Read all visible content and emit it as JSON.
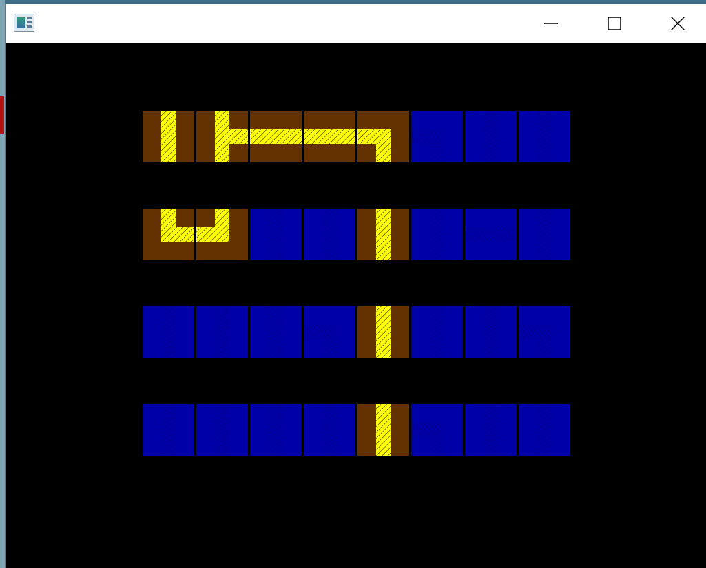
{
  "window": {
    "title": "",
    "controls": {
      "minimize_icon": "minimize-icon",
      "maximize_icon": "maximize-icon",
      "close_icon": "close-icon"
    }
  },
  "colors": {
    "desktop": "#5f8f9a",
    "background": "#000000",
    "dirt": "#643200",
    "water": "#0000a8",
    "pipe": "#ffff00",
    "hatch": "#000000"
  },
  "board": {
    "rows": 4,
    "cols": 8,
    "tiles": [
      [
        {
          "type": "pipe",
          "shape": "vertical"
        },
        {
          "type": "pipe",
          "shape": "tee-right"
        },
        {
          "type": "pipe",
          "shape": "horizontal"
        },
        {
          "type": "pipe",
          "shape": "horizontal"
        },
        {
          "type": "pipe",
          "shape": "corner-left-down"
        },
        {
          "type": "water",
          "pattern": "corner"
        },
        {
          "type": "water",
          "pattern": "vertical"
        },
        {
          "type": "water",
          "pattern": "vertical"
        }
      ],
      [
        {
          "type": "pipe",
          "shape": "corner-up-right"
        },
        {
          "type": "pipe",
          "shape": "corner-up-left"
        },
        {
          "type": "water",
          "pattern": "vertical"
        },
        {
          "type": "water",
          "pattern": "vertical"
        },
        {
          "type": "pipe",
          "shape": "vertical"
        },
        {
          "type": "water",
          "pattern": "vertical"
        },
        {
          "type": "water",
          "pattern": "horizontal"
        },
        {
          "type": "water",
          "pattern": "vertical"
        }
      ],
      [
        {
          "type": "water",
          "pattern": "vertical"
        },
        {
          "type": "water",
          "pattern": "vertical"
        },
        {
          "type": "water",
          "pattern": "vertical"
        },
        {
          "type": "water",
          "pattern": "corner"
        },
        {
          "type": "pipe",
          "shape": "vertical"
        },
        {
          "type": "water",
          "pattern": "vertical"
        },
        {
          "type": "water",
          "pattern": "vertical"
        },
        {
          "type": "water",
          "pattern": "corner"
        }
      ],
      [
        {
          "type": "water",
          "pattern": "vertical"
        },
        {
          "type": "water",
          "pattern": "vertical"
        },
        {
          "type": "water",
          "pattern": "vertical"
        },
        {
          "type": "water",
          "pattern": "vertical"
        },
        {
          "type": "pipe",
          "shape": "vertical"
        },
        {
          "type": "water",
          "pattern": "corner"
        },
        {
          "type": "water",
          "pattern": "vertical"
        },
        {
          "type": "water",
          "pattern": "vertical"
        }
      ]
    ]
  }
}
